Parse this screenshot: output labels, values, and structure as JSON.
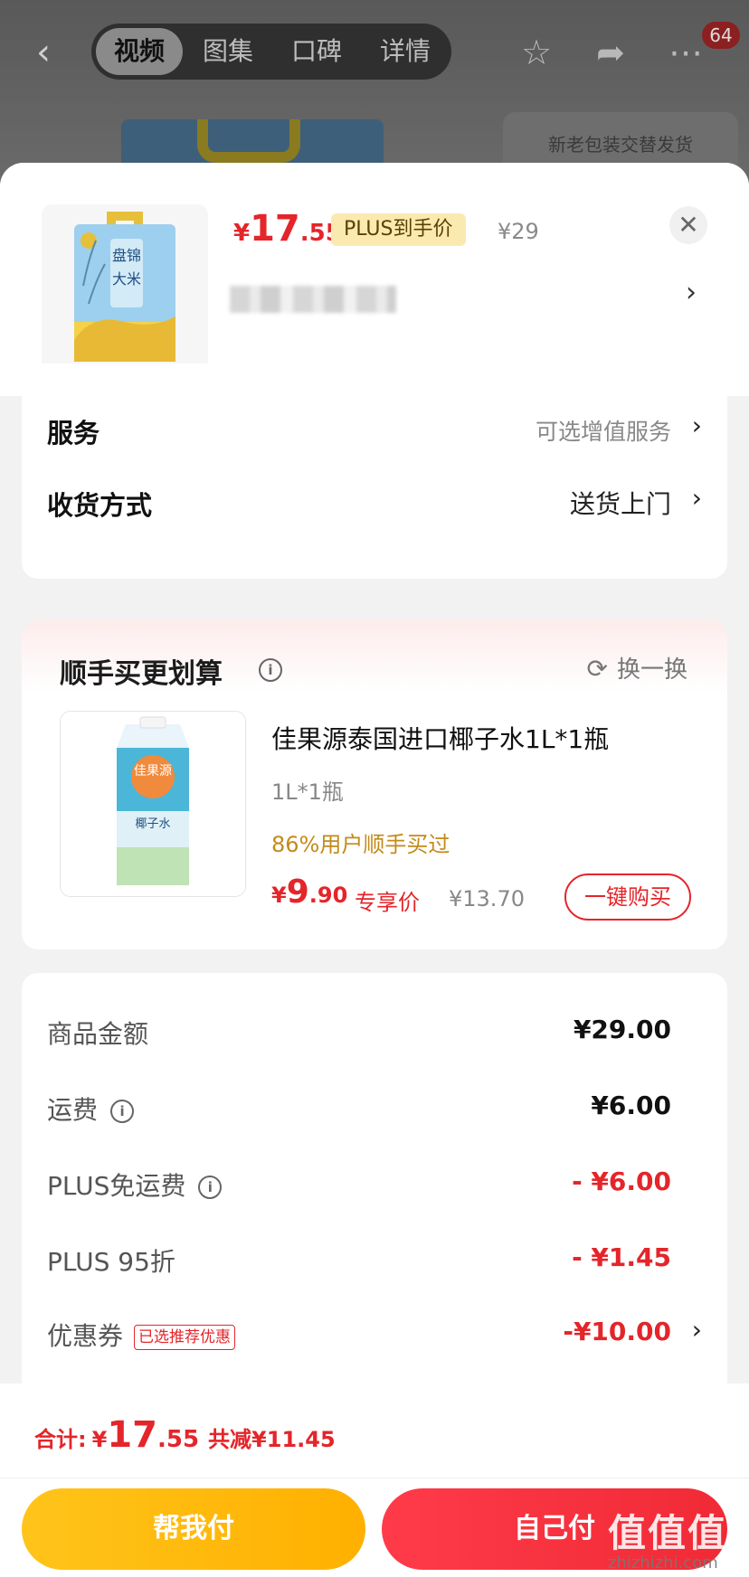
{
  "top_bar": {
    "tabs": [
      "视频",
      "图集",
      "口碑",
      "详情"
    ],
    "active_tab": 0,
    "notification_count": "64"
  },
  "background": {
    "card_text": "新老包装交替发货"
  },
  "product": {
    "price_yen": "¥",
    "price_int": "17",
    "price_dec": ".55",
    "plus_tag": "PLUS到手价",
    "original_price": "¥29",
    "package_text_line1": "盘锦",
    "package_text_line2": "大米"
  },
  "options": {
    "service_label": "服务",
    "service_value": "可选增值服务",
    "delivery_label": "收货方式",
    "delivery_value": "送货上门"
  },
  "upsell": {
    "title": "顺手买更划算",
    "swap_label": "换一换",
    "item_name": "佳果源泰国进口椰子水1L*1瓶",
    "item_spec": "1L*1瓶",
    "bought_text": "86%用户顺手买过",
    "price_yen": "¥",
    "price_int": "9",
    "price_dec": ".90",
    "exclusive_label": "专享价",
    "original_price": "¥13.70",
    "buy_button": "一键购买",
    "package_brand": "佳果源",
    "package_label": "椰子水"
  },
  "summary": {
    "rows": [
      {
        "label": "商品金额",
        "value": "¥29.00"
      },
      {
        "label": "运费",
        "value": "¥6.00"
      },
      {
        "label": "PLUS免运费",
        "value": "- ¥6.00"
      },
      {
        "label": "PLUS 95折",
        "value": "- ¥1.45"
      },
      {
        "label": "优惠券",
        "value": "-¥10.00",
        "tag": "已选推荐优惠"
      }
    ]
  },
  "footer": {
    "total_label": "合计:",
    "total_yen": "¥",
    "total_int": "17",
    "total_dec": ".55",
    "total_saved": "共减¥11.45",
    "help_pay": "帮我付",
    "self_pay": "自己付"
  },
  "watermark": {
    "text": "值值值",
    "url": "zhizhizhi.com"
  },
  "colors": {
    "accent_red": "#e4252a",
    "gold": "#ffb000",
    "bought_text": "#c48a1a"
  }
}
